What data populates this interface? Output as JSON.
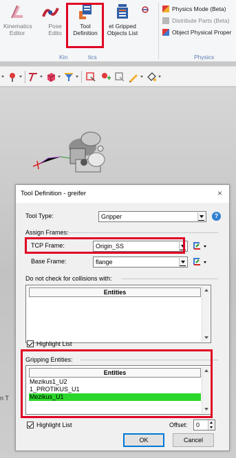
{
  "ribbon": {
    "kinematics_editor": "Kinematics Editor",
    "kin_line1": "Kinematics",
    "kin_line2": "Editor",
    "pose_line1": "Pose",
    "pose_line2": "Edito",
    "tool_line1": "Tool",
    "tool_line2": "Definition",
    "gripped_line1": "et Gripped",
    "gripped_line2": "Objects List",
    "group_label_partial": "Kin",
    "group_label_tail": "tics",
    "physics_mode": "Physics Mode (Beta)",
    "distribute_parts": "Distribute Parts (Beta)",
    "object_physical": "Object Physical Proper",
    "physics_group": "Physics"
  },
  "dialog": {
    "title": "Tool Definition - greifer",
    "close_glyph": "×",
    "tool_type_label": "Tool Type:",
    "tool_type_value": "Gripper",
    "help_glyph": "?",
    "assign_frames_label": "Assign Frames:",
    "tcp_frame_label": "TCP Frame:",
    "tcp_frame_value": "Origin_SS",
    "base_frame_label": "Base Frame:",
    "base_frame_value": "flange",
    "collisions_label": "Do not check for collisions with:",
    "collisions_header": "Entities",
    "highlight_list_label": "Highlight List",
    "gripping_label": "Gripping Entities:",
    "gripping_header": "Entities",
    "gripping_rows": [
      "Mezikus1_U2",
      "1_PROTIKUS_U1",
      "Mezikus_U1"
    ],
    "highlight_list_label_2": "Highlight List",
    "offset_label": "Offset:",
    "offset_value": "0",
    "ok_label": "OK",
    "cancel_label": "Cancel"
  },
  "edge_text": "n T",
  "colors": {
    "highlight_red": "#e00023",
    "selection_green": "#2bd72b",
    "ribbon_group": "#5a7db5"
  }
}
